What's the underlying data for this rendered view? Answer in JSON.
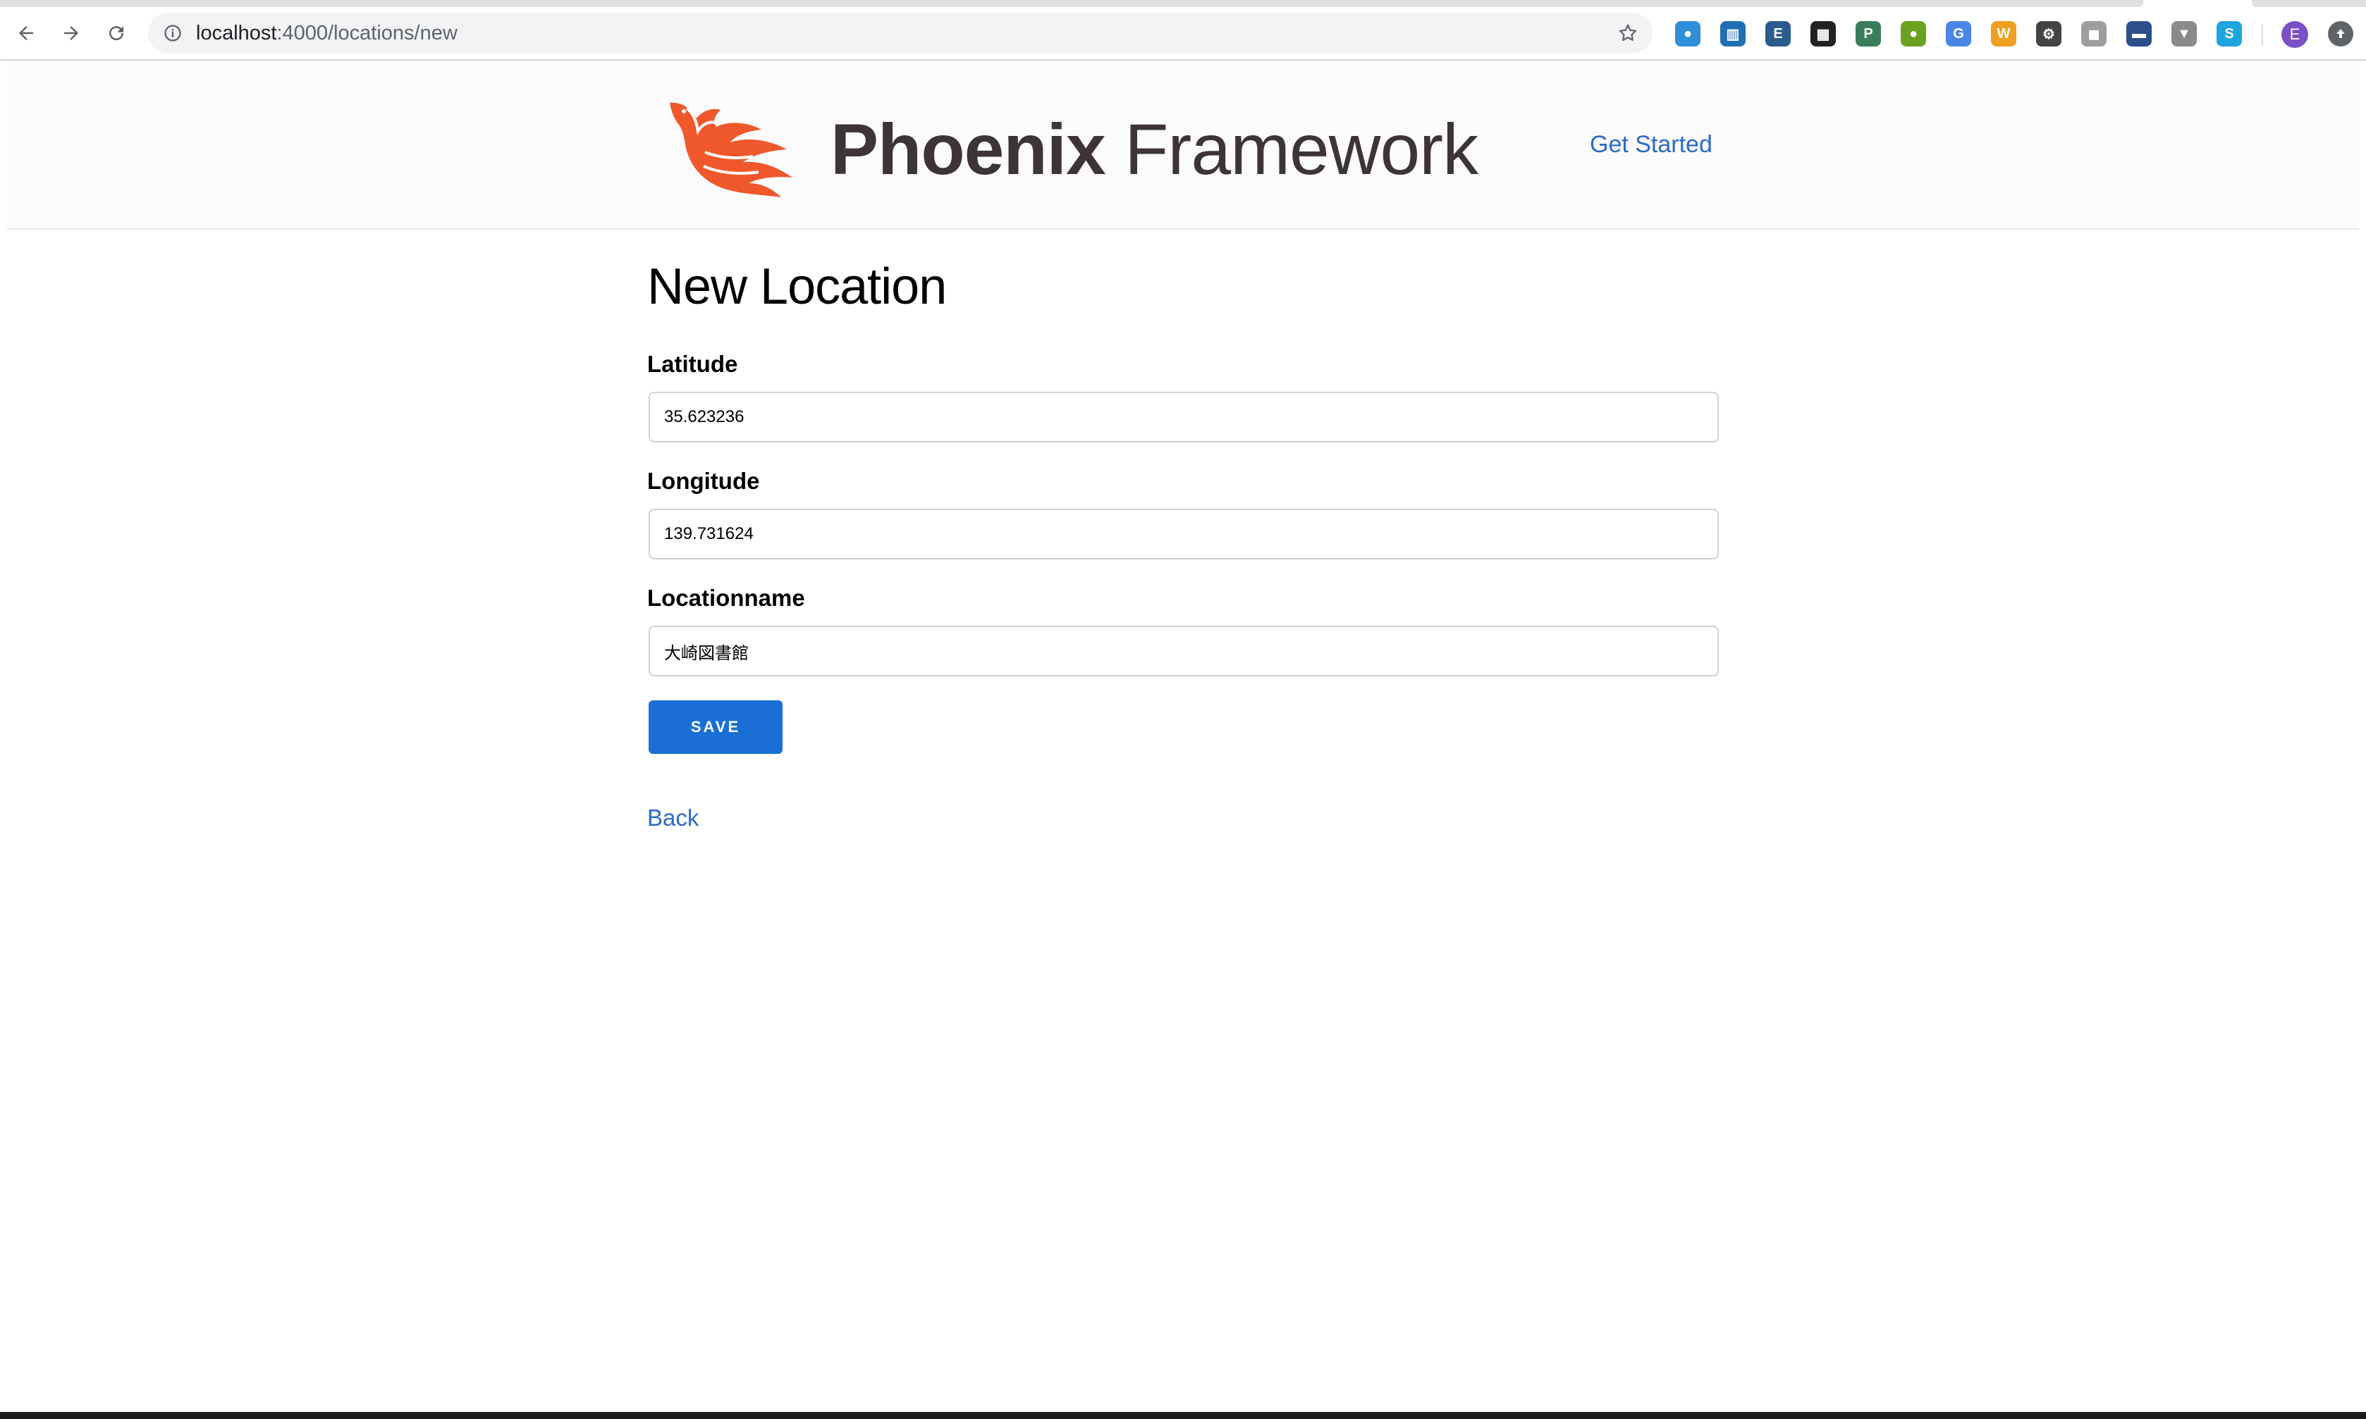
{
  "browser": {
    "url_host": "localhost",
    "url_path": ":4000/locations/new",
    "avatar_letter": "E",
    "extensions": [
      {
        "name": "globe-extension-icon",
        "glyph": "●",
        "color": "#2f8fd8"
      },
      {
        "name": "trello-extension-icon",
        "glyph": "▥",
        "color": "#1f6fb2"
      },
      {
        "name": "evernote-like-extension-icon",
        "glyph": "E",
        "color": "#2b5b8f"
      },
      {
        "name": "qr-code-extension-icon",
        "glyph": "▦",
        "color": "#222222"
      },
      {
        "name": "p-extension-icon",
        "glyph": "P",
        "color": "#3a7d5b"
      },
      {
        "name": "green-circle-extension-icon",
        "glyph": "●",
        "color": "#6aa220"
      },
      {
        "name": "translate-extension-icon",
        "glyph": "G",
        "color": "#4a86e8"
      },
      {
        "name": "w-extension-icon",
        "glyph": "W",
        "color": "#f0a020"
      },
      {
        "name": "gear-extension-icon",
        "glyph": "⚙",
        "color": "#444444"
      },
      {
        "name": "chat-extension-icon",
        "glyph": "◼",
        "color": "#9e9e9e"
      },
      {
        "name": "monitor-extension-icon",
        "glyph": "▬",
        "color": "#2c4e8a"
      },
      {
        "name": "vuejs-extension-icon",
        "glyph": "▼",
        "color": "#8a8a8a"
      },
      {
        "name": "skype-extension-icon",
        "glyph": "S",
        "color": "#1ea5e0"
      }
    ]
  },
  "header": {
    "logo_bold": "Phoenix",
    "logo_light": "Framework",
    "nav_link": "Get Started"
  },
  "form": {
    "title": "New Location",
    "latitude_label": "Latitude",
    "latitude_value": "35.623236",
    "longitude_label": "Longitude",
    "longitude_value": "139.731624",
    "locationname_label": "Locationname",
    "locationname_value": "大崎図書館",
    "save_label": "SAVE",
    "back_label": "Back"
  },
  "colors": {
    "link": "#2a6ac9",
    "button": "#1a6fd6",
    "phoenix_orange": "#f0582c",
    "logo_text": "#3d3535"
  }
}
